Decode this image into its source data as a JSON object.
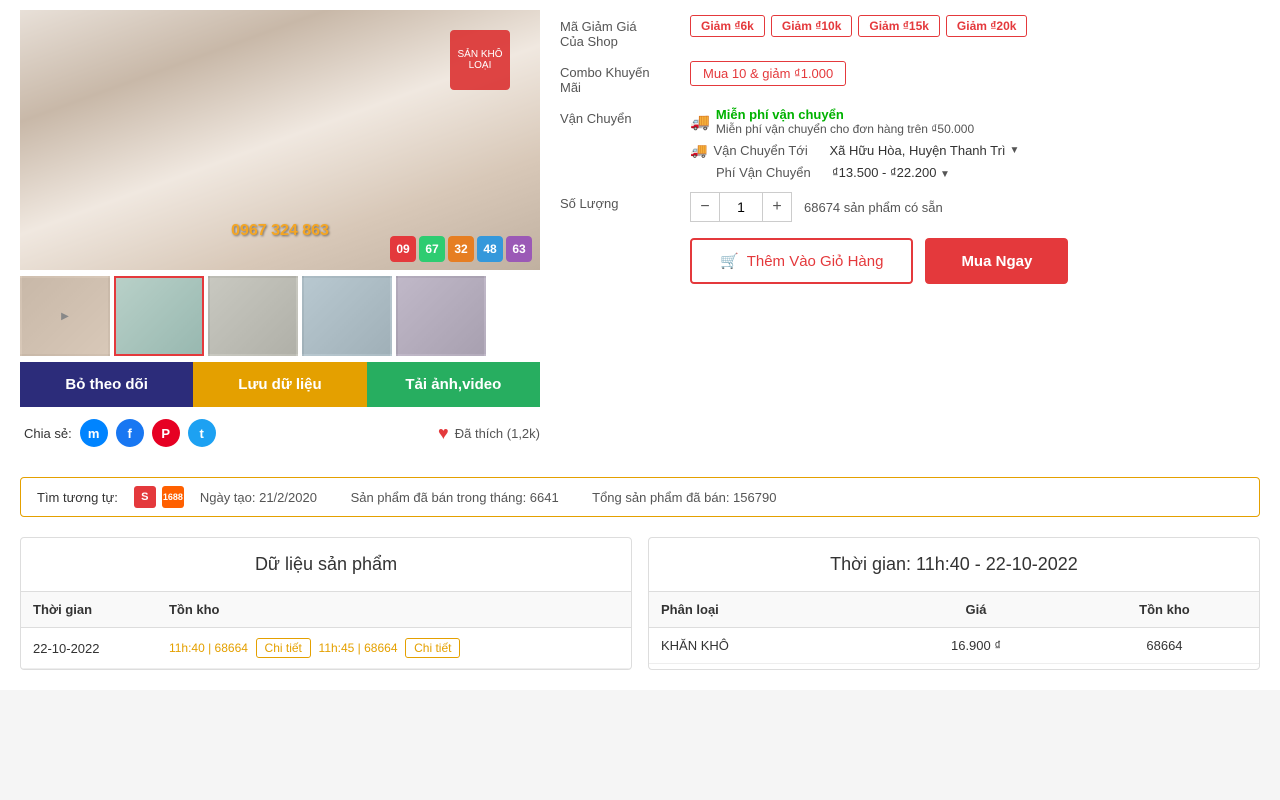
{
  "product": {
    "phone": "0967 324 863",
    "image_alt": "Product main image"
  },
  "numbers": [
    "09",
    "67",
    "32",
    "48",
    "63"
  ],
  "number_colors": [
    "#e4393c",
    "#2ecc71",
    "#e67e22",
    "#3498db",
    "#9b59b6"
  ],
  "thumbnails": [
    {
      "label": "▶",
      "active": false
    },
    {
      "label": "",
      "active": true
    },
    {
      "label": "",
      "active": false
    },
    {
      "label": "",
      "active": false
    },
    {
      "label": "",
      "active": false
    }
  ],
  "action_buttons": {
    "follow": "Bỏ theo dõi",
    "save": "Lưu dữ liệu",
    "download": "Tải ảnh,video"
  },
  "share": {
    "label": "Chia sẻ:"
  },
  "like": {
    "text": "Đã thích (1,2k)"
  },
  "info": {
    "discount_label": "Mã Giảm Giá\nCủa Shop",
    "discounts": [
      "Giảm ₫6k",
      "Giảm ₫10k",
      "Giảm ₫15k",
      "Giảm ₫20k"
    ],
    "combo_label": "Combo Khuyến\nMãi",
    "combo_text": "Mua 10 & giảm ₫1.000",
    "shipping_label": "Vận Chuyển",
    "shipping_free_text": "Miễn phí vận chuyển",
    "shipping_free_sub": "Miễn phí vận chuyển cho đơn hàng trên ₫50.000",
    "shipping_to_label": "Vận Chuyển Tới",
    "shipping_location": "Xã Hữu Hòa, Huyện Thanh Trì",
    "shipping_fee_label": "Phí Vận Chuyển",
    "shipping_fee": "₫13.500 - ₫22.200",
    "qty_label": "Số Lượng",
    "qty_value": "1",
    "stock_text": "68674 sản phẩm có sẵn",
    "btn_add_cart": "Thêm Vào Giỏ Hàng",
    "btn_buy_now": "Mua Ngay"
  },
  "similar": {
    "label": "Tìm tương tự:",
    "created_date": "Ngày tạo: 21/2/2020",
    "sold_month": "Sản phẩm đã bán trong tháng: 6641",
    "sold_total": "Tổng sản phẩm đã bán: 156790"
  },
  "data_table": {
    "title": "Dữ liệu sản phẩm",
    "col_time": "Thời gian",
    "col_stock": "Tồn kho",
    "rows": [
      {
        "date": "22-10-2022",
        "entries": [
          {
            "time": "11h:40",
            "stock": "68664"
          },
          {
            "time": "11h:45",
            "stock": "68664"
          }
        ]
      }
    ],
    "detail_btn": "Chi tiết"
  },
  "time_table": {
    "title": "Thời gian: 11h:40 - 22-10-2022",
    "col_category": "Phân loại",
    "col_price": "Giá",
    "col_stock": "Tồn kho",
    "rows": [
      {
        "category": "KHĂN KHÔ",
        "price": "16.900 ₫",
        "stock": "68664"
      }
    ]
  }
}
